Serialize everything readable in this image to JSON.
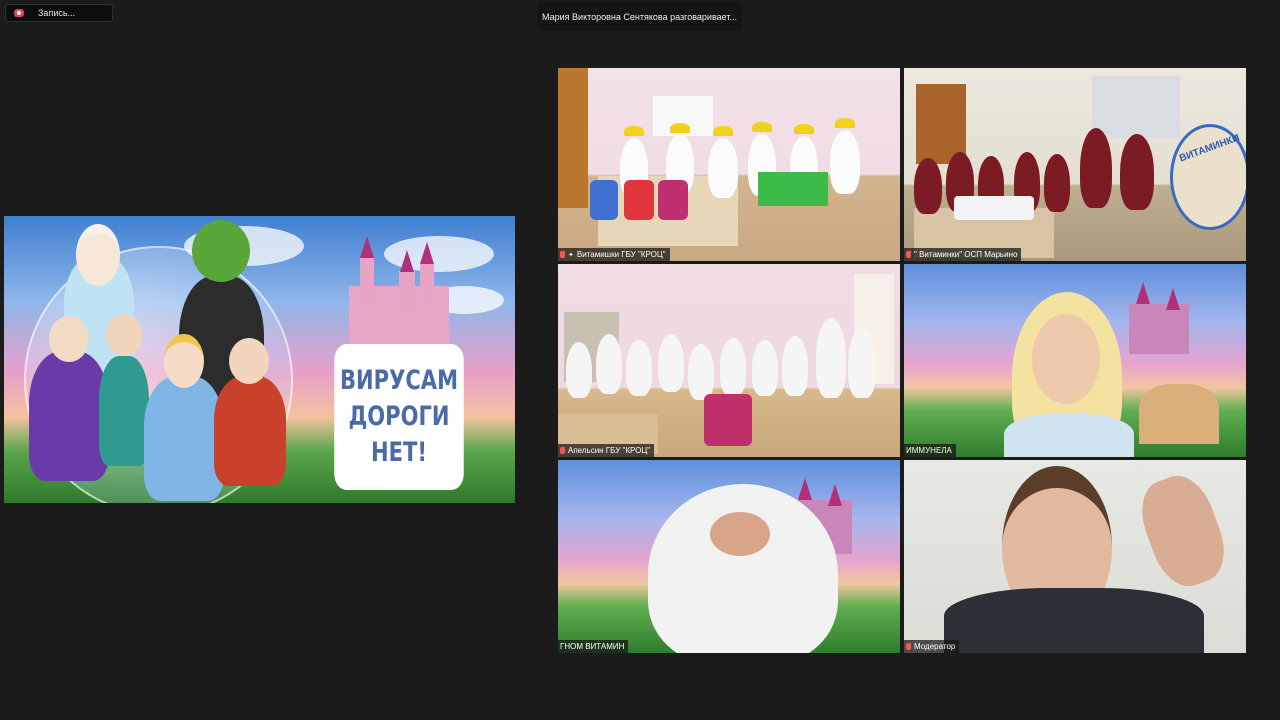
{
  "topbar": {
    "recording_label": "Запись...",
    "speaker_banner": "Мария Викторовна Сентякова разговаривает..."
  },
  "share": {
    "slogan_line1": "ВИРУСАМ",
    "slogan_line2": "ДОРОГИ",
    "slogan_line3": "НЕТ!"
  },
  "participants": [
    {
      "name": "Витамишки ГБУ \"КРОЦ\"",
      "muted": true,
      "pinned": true
    },
    {
      "name": "\" Витаминки\" ОСП Марьино",
      "muted": true,
      "pinned": false
    },
    {
      "name": "Апельсин ГБУ \"КРОЦ\"",
      "muted": true,
      "pinned": false
    },
    {
      "name": "ИММУНЕЛА",
      "muted": false,
      "pinned": false
    },
    {
      "name": "ГНОМ ВИТАМИН",
      "muted": false,
      "pinned": false
    },
    {
      "name": "Модератор",
      "muted": true,
      "pinned": false
    }
  ],
  "sign_text": "ВИТАМИНКИ",
  "colors": {
    "background": "#1b1b1b",
    "slogan_text": "#4a6aa8",
    "muted_mic": "#ff5252"
  }
}
